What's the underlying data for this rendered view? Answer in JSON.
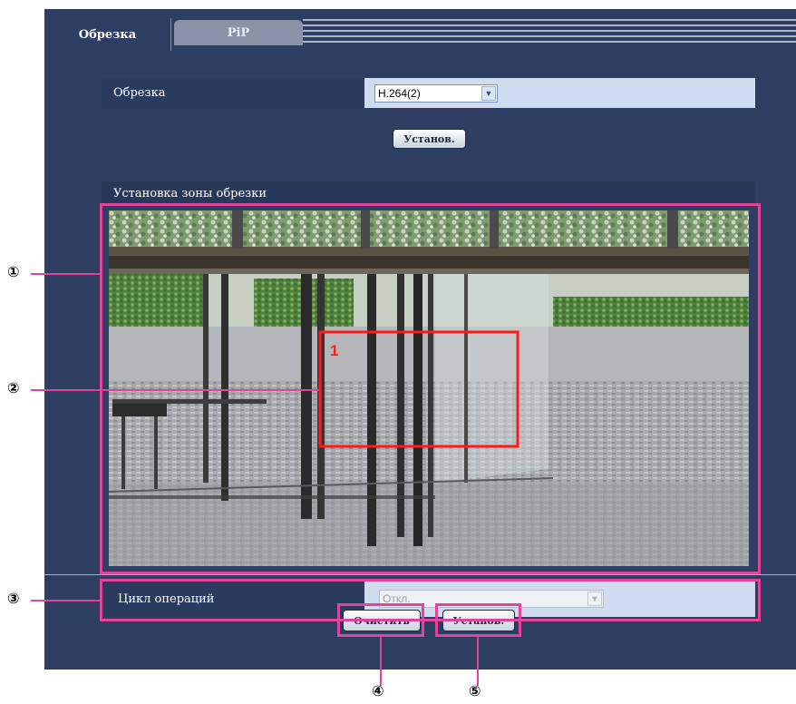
{
  "tabs": [
    {
      "label": "Обрезка",
      "active": true
    },
    {
      "label": "PiP",
      "active": false
    }
  ],
  "crop_row": {
    "label": "Обрезка",
    "select_value": "H.264(2)"
  },
  "set_button_top": "Установ.",
  "zone_section": {
    "title": "Установка зоны обрезки",
    "crop_area_number": "1"
  },
  "cycle_row": {
    "label": "Цикл операций",
    "select_value": "Откл."
  },
  "bottom_buttons": {
    "clear": "Очистить",
    "set": "Установ."
  },
  "callouts": [
    "①",
    "②",
    "③",
    "④",
    "⑤"
  ],
  "colors": {
    "panel": "#2e3e63",
    "callout_pink": "#e0459b",
    "crop_frame": "#ff1a1a",
    "value_bg": "#cfdbee"
  }
}
